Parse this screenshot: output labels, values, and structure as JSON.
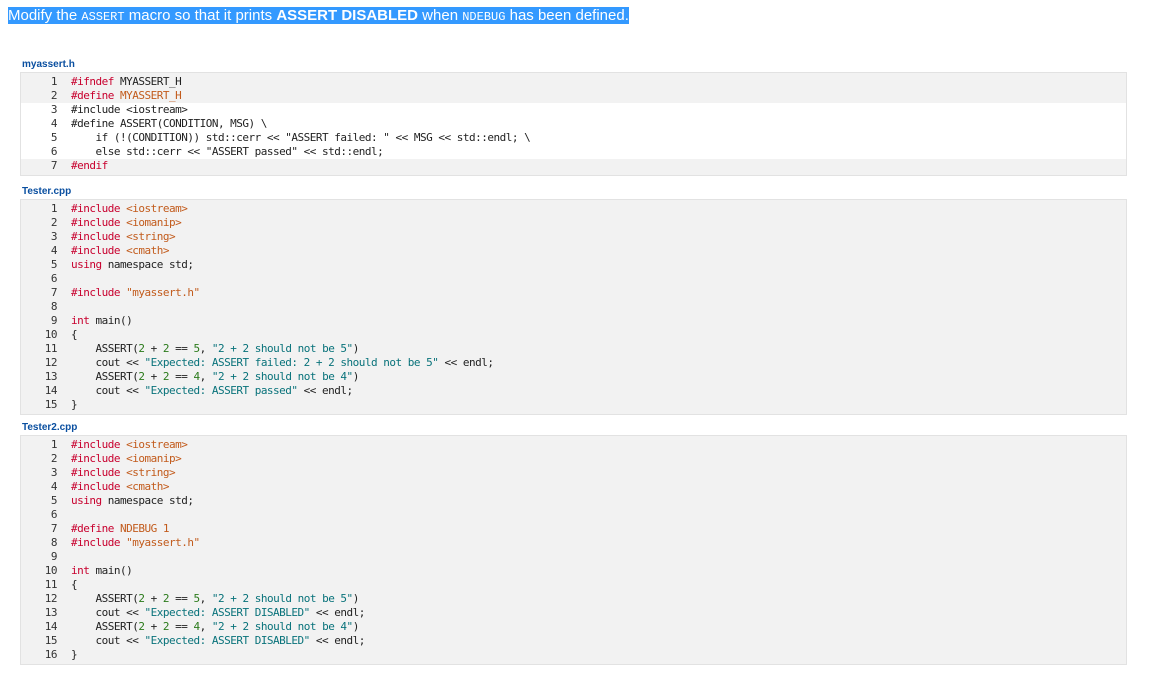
{
  "prompt": {
    "part1": "Modify the ",
    "code1": "ASSERT",
    "part2": " macro so that it prints ",
    "bold": "ASSERT DISABLED",
    "part3": " when ",
    "code2": "NDEBUG",
    "part4": " has been defined."
  },
  "files": [
    {
      "title": "myassert.h",
      "lines": [
        {
          "n": "1",
          "bg": "gray",
          "tokens": [
            {
              "t": "#ifndef ",
              "c": "kw"
            },
            {
              "t": "MYASSERT_H",
              "c": ""
            }
          ]
        },
        {
          "n": "2",
          "bg": "gray",
          "tokens": [
            {
              "t": "#define ",
              "c": "kw"
            },
            {
              "t": "MYASSERT_H",
              "c": "str"
            }
          ]
        },
        {
          "n": "3",
          "bg": "white",
          "tokens": [
            {
              "t": "#include <iostream>",
              "c": ""
            }
          ]
        },
        {
          "n": "4",
          "bg": "white",
          "tokens": [
            {
              "t": "#define ASSERT(CONDITION, MSG) \\",
              "c": ""
            }
          ]
        },
        {
          "n": "5",
          "bg": "white",
          "tokens": [
            {
              "t": "    if (!(CONDITION)) std::cerr << \"ASSERT failed: \" << MSG << std::endl; \\",
              "c": ""
            }
          ]
        },
        {
          "n": "6",
          "bg": "white",
          "tokens": [
            {
              "t": "    else std::cerr << \"ASSERT passed\" << std::endl;",
              "c": ""
            }
          ]
        },
        {
          "n": "7",
          "bg": "gray",
          "tokens": [
            {
              "t": "#endif",
              "c": "kw"
            }
          ]
        }
      ]
    },
    {
      "title": "Tester.cpp",
      "lines": [
        {
          "n": "1",
          "bg": "gray",
          "tokens": [
            {
              "t": "#include ",
              "c": "kw"
            },
            {
              "t": "<iostream>",
              "c": "str"
            }
          ]
        },
        {
          "n": "2",
          "bg": "gray",
          "tokens": [
            {
              "t": "#include ",
              "c": "kw"
            },
            {
              "t": "<iomanip>",
              "c": "str"
            }
          ]
        },
        {
          "n": "3",
          "bg": "gray",
          "tokens": [
            {
              "t": "#include ",
              "c": "kw"
            },
            {
              "t": "<string>",
              "c": "str"
            }
          ]
        },
        {
          "n": "4",
          "bg": "gray",
          "tokens": [
            {
              "t": "#include ",
              "c": "kw"
            },
            {
              "t": "<cmath>",
              "c": "str"
            }
          ]
        },
        {
          "n": "5",
          "bg": "gray",
          "tokens": [
            {
              "t": "using ",
              "c": "kw"
            },
            {
              "t": "namespace std;",
              "c": ""
            }
          ]
        },
        {
          "n": "6",
          "bg": "gray",
          "tokens": []
        },
        {
          "n": "7",
          "bg": "gray",
          "tokens": [
            {
              "t": "#include ",
              "c": "kw"
            },
            {
              "t": "\"myassert.h\"",
              "c": "str"
            }
          ]
        },
        {
          "n": "8",
          "bg": "gray",
          "tokens": []
        },
        {
          "n": "9",
          "bg": "gray",
          "tokens": [
            {
              "t": "int ",
              "c": "kw"
            },
            {
              "t": "main()",
              "c": ""
            }
          ]
        },
        {
          "n": "10",
          "bg": "gray",
          "tokens": [
            {
              "t": "{",
              "c": ""
            }
          ]
        },
        {
          "n": "11",
          "bg": "gray",
          "tokens": [
            {
              "t": "    ASSERT(",
              "c": ""
            },
            {
              "t": "2",
              "c": "num"
            },
            {
              "t": " + ",
              "c": ""
            },
            {
              "t": "2",
              "c": "num"
            },
            {
              "t": " == ",
              "c": ""
            },
            {
              "t": "5",
              "c": "num"
            },
            {
              "t": ", ",
              "c": ""
            },
            {
              "t": "\"2 + 2 should not be 5\"",
              "c": "lit"
            },
            {
              "t": ")",
              "c": ""
            }
          ]
        },
        {
          "n": "12",
          "bg": "gray",
          "tokens": [
            {
              "t": "    cout << ",
              "c": ""
            },
            {
              "t": "\"Expected: ASSERT failed: 2 + 2 should not be 5\"",
              "c": "lit"
            },
            {
              "t": " << endl;",
              "c": ""
            }
          ]
        },
        {
          "n": "13",
          "bg": "gray",
          "tokens": [
            {
              "t": "    ASSERT(",
              "c": ""
            },
            {
              "t": "2",
              "c": "num"
            },
            {
              "t": " + ",
              "c": ""
            },
            {
              "t": "2",
              "c": "num"
            },
            {
              "t": " == ",
              "c": ""
            },
            {
              "t": "4",
              "c": "num"
            },
            {
              "t": ", ",
              "c": ""
            },
            {
              "t": "\"2 + 2 should not be 4\"",
              "c": "lit"
            },
            {
              "t": ")",
              "c": ""
            }
          ]
        },
        {
          "n": "14",
          "bg": "gray",
          "tokens": [
            {
              "t": "    cout << ",
              "c": ""
            },
            {
              "t": "\"Expected: ASSERT passed\"",
              "c": "lit"
            },
            {
              "t": " << endl;",
              "c": ""
            }
          ]
        },
        {
          "n": "15",
          "bg": "gray",
          "tokens": [
            {
              "t": "}",
              "c": ""
            }
          ]
        }
      ]
    },
    {
      "title": "Tester2.cpp",
      "lines": [
        {
          "n": "1",
          "bg": "gray",
          "tokens": [
            {
              "t": "#include ",
              "c": "kw"
            },
            {
              "t": "<iostream>",
              "c": "str"
            }
          ]
        },
        {
          "n": "2",
          "bg": "gray",
          "tokens": [
            {
              "t": "#include ",
              "c": "kw"
            },
            {
              "t": "<iomanip>",
              "c": "str"
            }
          ]
        },
        {
          "n": "3",
          "bg": "gray",
          "tokens": [
            {
              "t": "#include ",
              "c": "kw"
            },
            {
              "t": "<string>",
              "c": "str"
            }
          ]
        },
        {
          "n": "4",
          "bg": "gray",
          "tokens": [
            {
              "t": "#include ",
              "c": "kw"
            },
            {
              "t": "<cmath>",
              "c": "str"
            }
          ]
        },
        {
          "n": "5",
          "bg": "gray",
          "tokens": [
            {
              "t": "using ",
              "c": "kw"
            },
            {
              "t": "namespace std;",
              "c": ""
            }
          ]
        },
        {
          "n": "6",
          "bg": "gray",
          "tokens": []
        },
        {
          "n": "7",
          "bg": "gray",
          "tokens": [
            {
              "t": "#define ",
              "c": "kw"
            },
            {
              "t": "NDEBUG 1",
              "c": "str"
            }
          ]
        },
        {
          "n": "8",
          "bg": "gray",
          "tokens": [
            {
              "t": "#include ",
              "c": "kw"
            },
            {
              "t": "\"myassert.h\"",
              "c": "str"
            }
          ]
        },
        {
          "n": "9",
          "bg": "gray",
          "tokens": []
        },
        {
          "n": "10",
          "bg": "gray",
          "tokens": [
            {
              "t": "int ",
              "c": "kw"
            },
            {
              "t": "main()",
              "c": ""
            }
          ]
        },
        {
          "n": "11",
          "bg": "gray",
          "tokens": [
            {
              "t": "{",
              "c": ""
            }
          ]
        },
        {
          "n": "12",
          "bg": "gray",
          "tokens": [
            {
              "t": "    ASSERT(",
              "c": ""
            },
            {
              "t": "2",
              "c": "num"
            },
            {
              "t": " + ",
              "c": ""
            },
            {
              "t": "2",
              "c": "num"
            },
            {
              "t": " == ",
              "c": ""
            },
            {
              "t": "5",
              "c": "num"
            },
            {
              "t": ", ",
              "c": ""
            },
            {
              "t": "\"2 + 2 should not be 5\"",
              "c": "lit"
            },
            {
              "t": ")",
              "c": ""
            }
          ]
        },
        {
          "n": "13",
          "bg": "gray",
          "tokens": [
            {
              "t": "    cout << ",
              "c": ""
            },
            {
              "t": "\"Expected: ASSERT DISABLED\"",
              "c": "lit"
            },
            {
              "t": " << endl;",
              "c": ""
            }
          ]
        },
        {
          "n": "14",
          "bg": "gray",
          "tokens": [
            {
              "t": "    ASSERT(",
              "c": ""
            },
            {
              "t": "2",
              "c": "num"
            },
            {
              "t": " + ",
              "c": ""
            },
            {
              "t": "2",
              "c": "num"
            },
            {
              "t": " == ",
              "c": ""
            },
            {
              "t": "4",
              "c": "num"
            },
            {
              "t": ", ",
              "c": ""
            },
            {
              "t": "\"2 + 2 should not be 4\"",
              "c": "lit"
            },
            {
              "t": ")",
              "c": ""
            }
          ]
        },
        {
          "n": "15",
          "bg": "gray",
          "tokens": [
            {
              "t": "    cout << ",
              "c": ""
            },
            {
              "t": "\"Expected: ASSERT DISABLED\"",
              "c": "lit"
            },
            {
              "t": " << endl;",
              "c": ""
            }
          ]
        },
        {
          "n": "16",
          "bg": "gray",
          "tokens": [
            {
              "t": "}",
              "c": ""
            }
          ]
        }
      ]
    }
  ]
}
